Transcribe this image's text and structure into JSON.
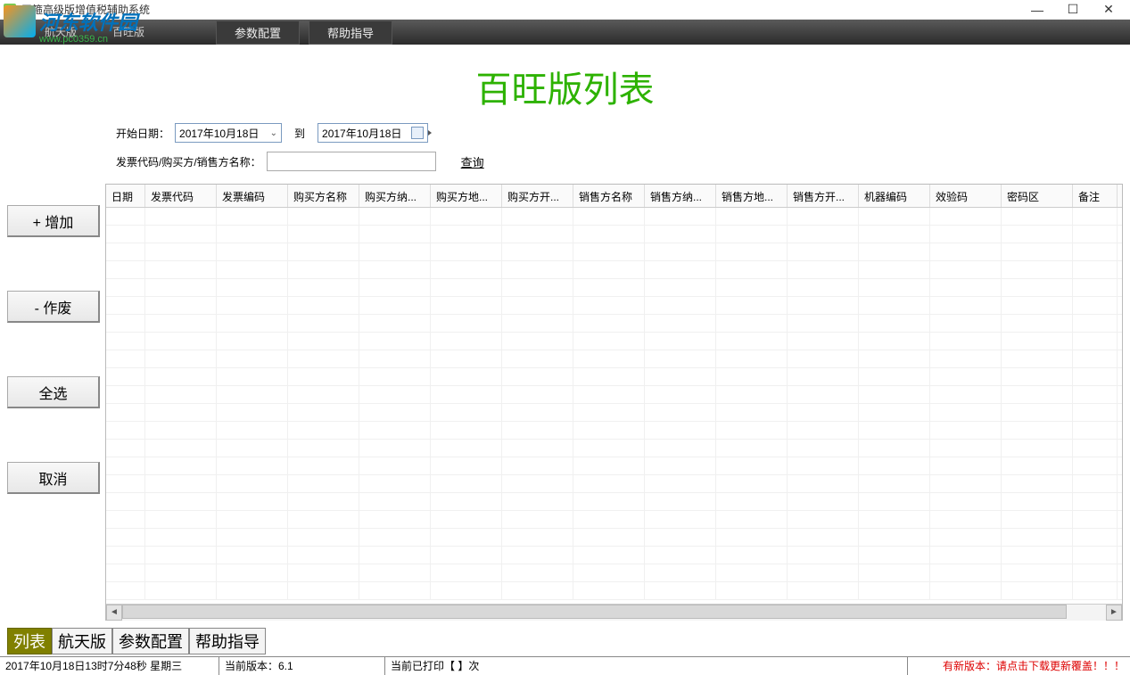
{
  "window": {
    "title": "天箍高级版增值税辅助系统",
    "minimize": "—",
    "maximize": "☐",
    "close": "✕"
  },
  "watermark": {
    "brand": "河东软件园",
    "url": "www.pc0359.cn"
  },
  "menubar": {
    "items": [
      "航天版",
      "百旺版"
    ],
    "buttons": [
      "参数配置",
      "帮助指导"
    ]
  },
  "page_title": "百旺版列表",
  "search": {
    "start_label": "开始日期：",
    "start_value": "2017年10月18日",
    "to_label": "到",
    "end_value": "2017年10月18日",
    "code_label": "发票代码/购买方/销售方名称：",
    "code_value": "",
    "query": "查询"
  },
  "side_buttons": {
    "add": "+ 增加",
    "void": "- 作废",
    "select_all": "全选",
    "cancel": "取消"
  },
  "table": {
    "columns": [
      "日期",
      "发票代码",
      "发票编码",
      "购买方名称",
      "购买方纳...",
      "购买方地...",
      "购买方开...",
      "销售方名称",
      "销售方纳...",
      "销售方地...",
      "销售方开...",
      "机器编码",
      "效验码",
      "密码区",
      "备注"
    ]
  },
  "bottom_tabs": [
    "列表",
    "航天版",
    "参数配置",
    "帮助指导"
  ],
  "statusbar": {
    "datetime": "2017年10月18日13时7分48秒 星期三",
    "version": "当前版本：6.1",
    "printed": "当前已打印【 】次",
    "update": "有新版本：请点击下载更新覆盖！！！"
  }
}
